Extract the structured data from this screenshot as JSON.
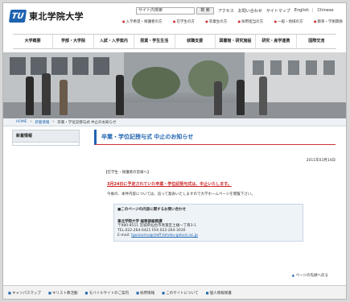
{
  "header": {
    "logo_mark": "TU",
    "logo_text": "東北学院大学",
    "search_placeholder": "サイト内検索",
    "search_button": "検 索",
    "top_links": [
      "アクセス",
      "お問い合わせ",
      "サイトマップ",
      "English",
      "Chinese"
    ],
    "audience_links": [
      "入学希望・保護者の方",
      "在学生の方",
      "卒業生の方",
      "採用担当の方",
      "一般・地域の方",
      "教育・学術関係"
    ]
  },
  "nav": [
    "大学概要",
    "学部・大学院",
    "入試・入学案内",
    "授業・学生生活",
    "就職支援",
    "図書館・研究施設",
    "研究・産学連携",
    "国際交流"
  ],
  "breadcrumb": {
    "home": "HOME",
    "section": "新着情報",
    "current": "卒業・学位記授与式 中止のお知らせ"
  },
  "sidebar": {
    "heading": "新着情報"
  },
  "main": {
    "title": "卒業・学位記授与式 中止のお知らせ",
    "date": "2011年03月14日",
    "greeting": "【在学生・保護者の皆様へ】",
    "notice": "3月24日に予定されていた卒業・学位記授与式は、中止いたします。",
    "body": "今後の、本件内容については、追って発表いたしますので大学ホームページを閲覧下さい。",
    "contact": {
      "heading": "■このページの内容に関するお問い合わせ",
      "org": "東北学院大学 総務部総務課",
      "address": "〒980-8511 宮城県仙台市青葉区土樋一丁目3-1",
      "tel": "TEL.022-264-6421 FAX.022-264-3030",
      "mail_label": "E-mail:",
      "mail": "tgusoumu@staff.tohoku-gakuin.ac.jp"
    },
    "pagetop": "ページの先頭へ戻る"
  },
  "footer": [
    "キャンパスマップ",
    "キリスト教活動",
    "モバイルサイトのご案内",
    "採用情報",
    "このサイトについて",
    "個人情報保護"
  ]
}
